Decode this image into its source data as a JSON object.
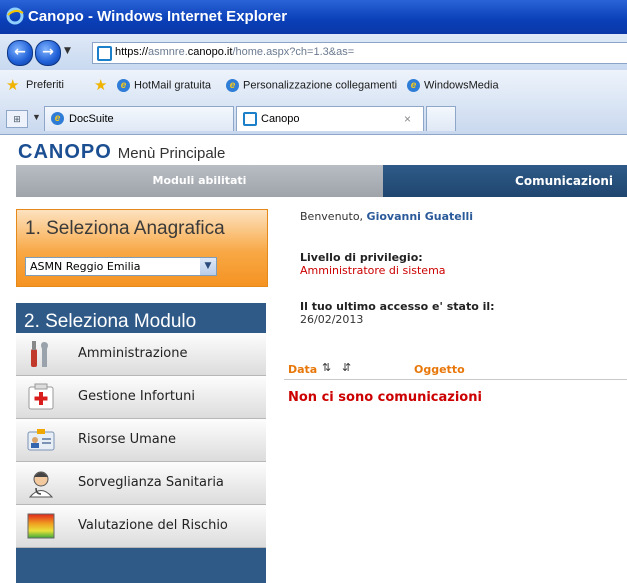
{
  "window": {
    "title": "Canopo - Windows Internet Explorer"
  },
  "address": {
    "url_prefix": "https://",
    "url_faded1": "asmnre.",
    "url_host": "canopo.it",
    "url_faded2": "/home.aspx?ch=1.3&as="
  },
  "favorites": {
    "label": "Preferiti",
    "links": [
      "HotMail gratuita",
      "Personalizzazione collegamenti",
      "WindowsMedia"
    ]
  },
  "tabs": [
    {
      "label": "DocSuite"
    },
    {
      "label": "Canopo",
      "close": "×"
    }
  ],
  "app": {
    "logo": "CANOPO",
    "subtitle": "Menù Principale",
    "header_left": "Moduli abilitati",
    "header_right": "Comunicazioni",
    "anagrafica": {
      "title": "1. Seleziona Anagrafica",
      "selected": "ASMN Reggio Emilia"
    },
    "modulo": {
      "title": "2. Seleziona Modulo",
      "items": [
        {
          "label": "Amministrazione",
          "icon": "tools-icon"
        },
        {
          "label": "Gestione Infortuni",
          "icon": "first-aid-icon"
        },
        {
          "label": "Risorse Umane",
          "icon": "id-card-icon"
        },
        {
          "label": "Sorveglianza Sanitaria",
          "icon": "doctor-icon"
        },
        {
          "label": "Valutazione del Rischio",
          "icon": "risk-gradient-icon"
        }
      ]
    },
    "main": {
      "welcome_prefix": "Benvenuto,",
      "user_name": "Giovanni Guatelli",
      "privilege_label": "Livello di privilegio:",
      "privilege_value": "Amministratore di sistema",
      "last_access_label": "Il tuo ultimo accesso e' stato il:",
      "last_access_value": "26/02/2013",
      "col_data": "Data",
      "col_oggetto": "Oggetto",
      "no_messages": "Non ci sono comunicazioni"
    }
  }
}
